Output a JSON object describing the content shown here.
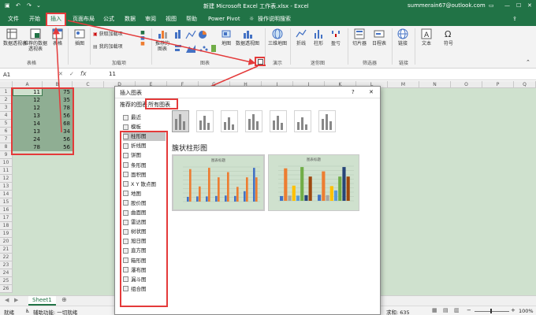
{
  "titlebar": {
    "doc_title": "新建 Microsoft Excel 工作表.xlsx  -  Excel",
    "user": "summerain67@outlook.com",
    "colors": {
      "excel_green": "#217346",
      "annotation_red": "#e43a3a"
    }
  },
  "tabs": [
    "文件",
    "开始",
    "插入",
    "页面布局",
    "公式",
    "数据",
    "审阅",
    "视图",
    "帮助",
    "Power Pivot"
  ],
  "tell_me": "操作说明搜索",
  "ribbon": {
    "buttons": {
      "pivot": "数据透视表",
      "rec_pivot": "推荐的数据透视表",
      "table": "表格",
      "illustrations": "插图",
      "get_addins": "获取加载项",
      "my_addins": "我的加载项",
      "rec_charts": "推荐的图表",
      "map": "地图",
      "pivot_chart": "数据透视图",
      "map3d": "三维地图",
      "line": "折线",
      "column": "柱形",
      "winloss": "盈亏",
      "slicer": "切片器",
      "timeline": "日程表",
      "link": "链接",
      "text": "文本",
      "symbol": "符号"
    },
    "groups": {
      "tables": "表格",
      "addins": "加载项",
      "charts": "图表",
      "tours": "演示",
      "sparklines": "迷你图",
      "filters": "筛选器",
      "links": "链接"
    }
  },
  "formula_bar": {
    "name_box": "A1",
    "fx": "fx",
    "value": "11"
  },
  "grid": {
    "columns": [
      "A",
      "B",
      "C",
      "D",
      "E",
      "F",
      "G",
      "H",
      "I",
      "J",
      "K",
      "L",
      "M",
      "N",
      "O",
      "P",
      "Q"
    ],
    "rows": [
      "1",
      "2",
      "3",
      "4",
      "5",
      "6",
      "7",
      "8",
      "9",
      "10",
      "11",
      "12",
      "13",
      "14",
      "15",
      "16",
      "17",
      "18",
      "19",
      "20",
      "21",
      "22",
      "23",
      "24",
      "25",
      "26"
    ],
    "data": [
      {
        "a": "11",
        "b": "75"
      },
      {
        "a": "12",
        "b": "35"
      },
      {
        "a": "12",
        "b": "78"
      },
      {
        "a": "13",
        "b": "56"
      },
      {
        "a": "14",
        "b": "68"
      },
      {
        "a": "13",
        "b": "34"
      },
      {
        "a": "24",
        "b": "56"
      },
      {
        "a": "78",
        "b": "56"
      }
    ]
  },
  "sheet_tab": "Sheet1",
  "status": {
    "ready": "就绪",
    "accessibility": "辅助功能: 一切就绪",
    "sum_label": "求和: 635",
    "zoom": "100%"
  },
  "dialog": {
    "title": "插入图表",
    "help": "?",
    "close": "✕",
    "tab_recommended": "推荐的图表",
    "tab_all": "所有图表",
    "categories": [
      "最近",
      "模板",
      "柱形图",
      "折线图",
      "饼图",
      "条形图",
      "面积图",
      "X Y 散点图",
      "地图",
      "股价图",
      "曲面图",
      "雷达图",
      "树状图",
      "旭日图",
      "直方图",
      "箱形图",
      "瀑布图",
      "漏斗图",
      "组合图"
    ],
    "selected_category": "柱形图",
    "subtype_heading": "簇状柱形图",
    "preview1_title": "图表标题",
    "preview2_title": "图表标题",
    "preview1_chart": {
      "type": "bar",
      "series": [
        {
          "values": [
            11,
            12,
            12,
            13,
            14,
            13,
            24,
            78
          ]
        },
        {
          "values": [
            75,
            35,
            78,
            56,
            68,
            34,
            56,
            56
          ]
        }
      ],
      "colors": [
        "#4472c4",
        "#ed7d31"
      ]
    },
    "preview2_chart": {
      "type": "bar",
      "values": [
        11,
        75,
        12,
        35,
        12,
        78,
        13,
        56,
        14,
        68,
        13,
        34,
        24,
        56,
        78,
        56
      ],
      "colors": [
        "#4472c4",
        "#ed7d31",
        "#a5a5a5",
        "#ffc000",
        "#5b9bd5",
        "#70ad47",
        "#264478",
        "#9e480e"
      ]
    }
  }
}
